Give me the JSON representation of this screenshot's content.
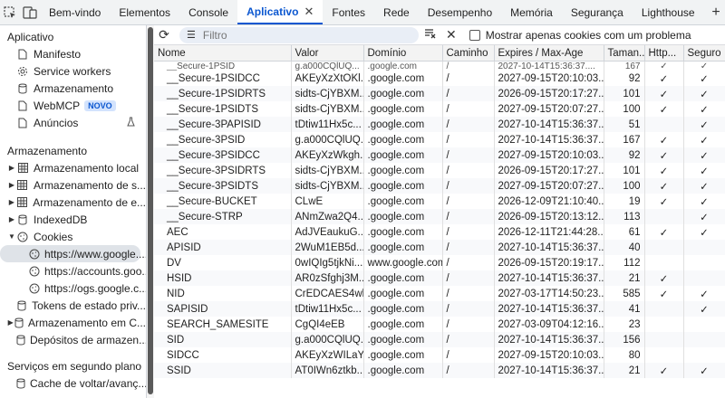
{
  "tabs": [
    {
      "label": "Bem-vindo"
    },
    {
      "label": "Elementos"
    },
    {
      "label": "Console"
    },
    {
      "label": "Aplicativo",
      "active": true
    },
    {
      "label": "Fontes"
    },
    {
      "label": "Rede"
    },
    {
      "label": "Desempenho"
    },
    {
      "label": "Memória"
    },
    {
      "label": "Segurança"
    },
    {
      "label": "Lighthouse"
    }
  ],
  "sidebar": {
    "app_title": "Aplicativo",
    "app_items": [
      "Manifesto",
      "Service workers",
      "Armazenamento",
      "WebMCP",
      "Anúncios"
    ],
    "webmcp_badge": "NOVO",
    "storage_title": "Armazenamento",
    "storage_items": [
      "Armazenamento local",
      "Armazenamento de s...",
      "Armazenamento de e...",
      "IndexedDB",
      "Cookies"
    ],
    "cookie_items": [
      "https://www.google....",
      "https://accounts.goo...",
      "https://ogs.google.c..."
    ],
    "more_items": [
      "Tokens de estado priv...",
      "Armazenamento em C...",
      "Depósitos de armazen..."
    ],
    "bg_title": "Serviços em segundo plano",
    "bg_items": [
      "Cache de voltar/avanç..."
    ]
  },
  "toolbar": {
    "filter_placeholder": "Filtro",
    "only_issues_label": "Mostrar apenas cookies com um problema"
  },
  "table": {
    "columns": [
      "Nome",
      "Valor",
      "Domínio",
      "Caminho",
      "Expires / Max-Age",
      "Taman...",
      "Http...",
      "Seguro"
    ],
    "top_partial": [
      "__Secure-1PSID",
      "g.a000CQlUQ...",
      ".google.com",
      "/",
      "2027-10-14T15:36:37....",
      "167",
      "✓",
      "✓"
    ],
    "rows": [
      [
        "__Secure-1PSIDCC",
        "AKEyXzXtOKl...",
        ".google.com",
        "/",
        "2027-09-15T20:10:03....",
        "92",
        "✓",
        "✓"
      ],
      [
        "__Secure-1PSIDRTS",
        "sidts-CjYBXM...",
        ".google.com",
        "/",
        "2026-09-15T20:17:27....",
        "101",
        "✓",
        "✓"
      ],
      [
        "__Secure-1PSIDTS",
        "sidts-CjYBXM...",
        ".google.com",
        "/",
        "2027-09-15T20:07:27....",
        "100",
        "✓",
        "✓"
      ],
      [
        "__Secure-3PAPISID",
        "tDtiw11Hx5c...",
        ".google.com",
        "/",
        "2027-10-14T15:36:37....",
        "51",
        "",
        "✓"
      ],
      [
        "__Secure-3PSID",
        "g.a000CQlUQ...",
        ".google.com",
        "/",
        "2027-10-14T15:36:37....",
        "167",
        "✓",
        "✓"
      ],
      [
        "__Secure-3PSIDCC",
        "AKEyXzWkgh...",
        ".google.com",
        "/",
        "2027-09-15T20:10:03....",
        "92",
        "✓",
        "✓"
      ],
      [
        "__Secure-3PSIDRTS",
        "sidts-CjYBXM...",
        ".google.com",
        "/",
        "2026-09-15T20:17:27....",
        "101",
        "✓",
        "✓"
      ],
      [
        "__Secure-3PSIDTS",
        "sidts-CjYBXM...",
        ".google.com",
        "/",
        "2027-09-15T20:07:27....",
        "100",
        "✓",
        "✓"
      ],
      [
        "__Secure-BUCKET",
        "CLwE",
        ".google.com",
        "/",
        "2026-12-09T21:10:40....",
        "19",
        "✓",
        "✓"
      ],
      [
        "__Secure-STRP",
        "ANmZwa2Q4...",
        ".google.com",
        "/",
        "2026-09-15T20:13:12....",
        "113",
        "",
        "✓"
      ],
      [
        "AEC",
        "AdJVEaukuG...",
        ".google.com",
        "/",
        "2026-12-11T21:44:28....",
        "61",
        "✓",
        "✓"
      ],
      [
        "APISID",
        "2WuM1EB5d...",
        ".google.com",
        "/",
        "2027-10-14T15:36:37....",
        "40",
        "",
        ""
      ],
      [
        "DV",
        "0wIQIg5tjkNi...",
        "www.google.com",
        "/",
        "2026-09-15T20:19:17....",
        "112",
        "",
        ""
      ],
      [
        "HSID",
        "AR0zSfghj3M...",
        ".google.com",
        "/",
        "2027-10-14T15:36:37....",
        "21",
        "✓",
        ""
      ],
      [
        "NID",
        "CrEDCAES4wl...",
        ".google.com",
        "/",
        "2027-03-17T14:50:23....",
        "585",
        "✓",
        "✓"
      ],
      [
        "SAPISID",
        "tDtiw11Hx5c...",
        ".google.com",
        "/",
        "2027-10-14T15:36:37....",
        "41",
        "",
        "✓"
      ],
      [
        "SEARCH_SAMESITE",
        "CgQI4eEB",
        ".google.com",
        "/",
        "2027-03-09T04:12:16....",
        "23",
        "",
        ""
      ],
      [
        "SID",
        "g.a000CQlUQ...",
        ".google.com",
        "/",
        "2027-10-14T15:36:37....",
        "156",
        "",
        ""
      ],
      [
        "SIDCC",
        "AKEyXzWILaY...",
        ".google.com",
        "/",
        "2027-09-15T20:10:03....",
        "80",
        "",
        ""
      ],
      [
        "SSID",
        "AT0IWn6ztkb...",
        ".google.com",
        "/",
        "2027-10-14T15:36:37....",
        "21",
        "✓",
        "✓"
      ]
    ]
  }
}
